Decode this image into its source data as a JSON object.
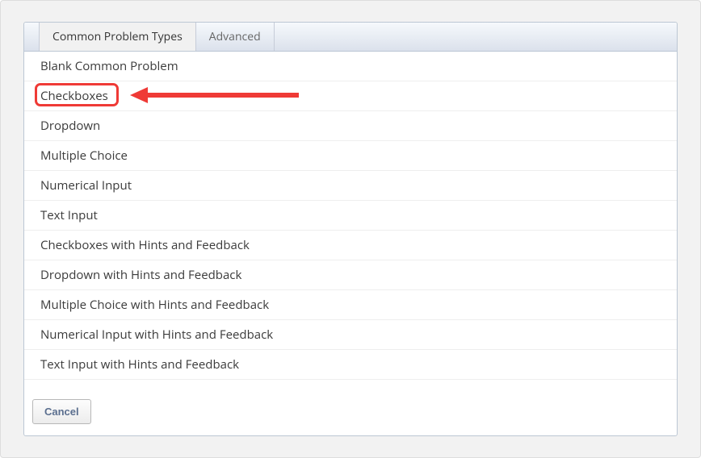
{
  "tabs": {
    "common": "Common Problem Types",
    "advanced": "Advanced"
  },
  "problemTypes": [
    "Blank Common Problem",
    "Checkboxes",
    "Dropdown",
    "Multiple Choice",
    "Numerical Input",
    "Text Input",
    "Checkboxes with Hints and Feedback",
    "Dropdown with Hints and Feedback",
    "Multiple Choice with Hints and Feedback",
    "Numerical Input with Hints and Feedback",
    "Text Input with Hints and Feedback"
  ],
  "buttons": {
    "cancel": "Cancel"
  },
  "annotation": {
    "highlighted_index": 1
  }
}
